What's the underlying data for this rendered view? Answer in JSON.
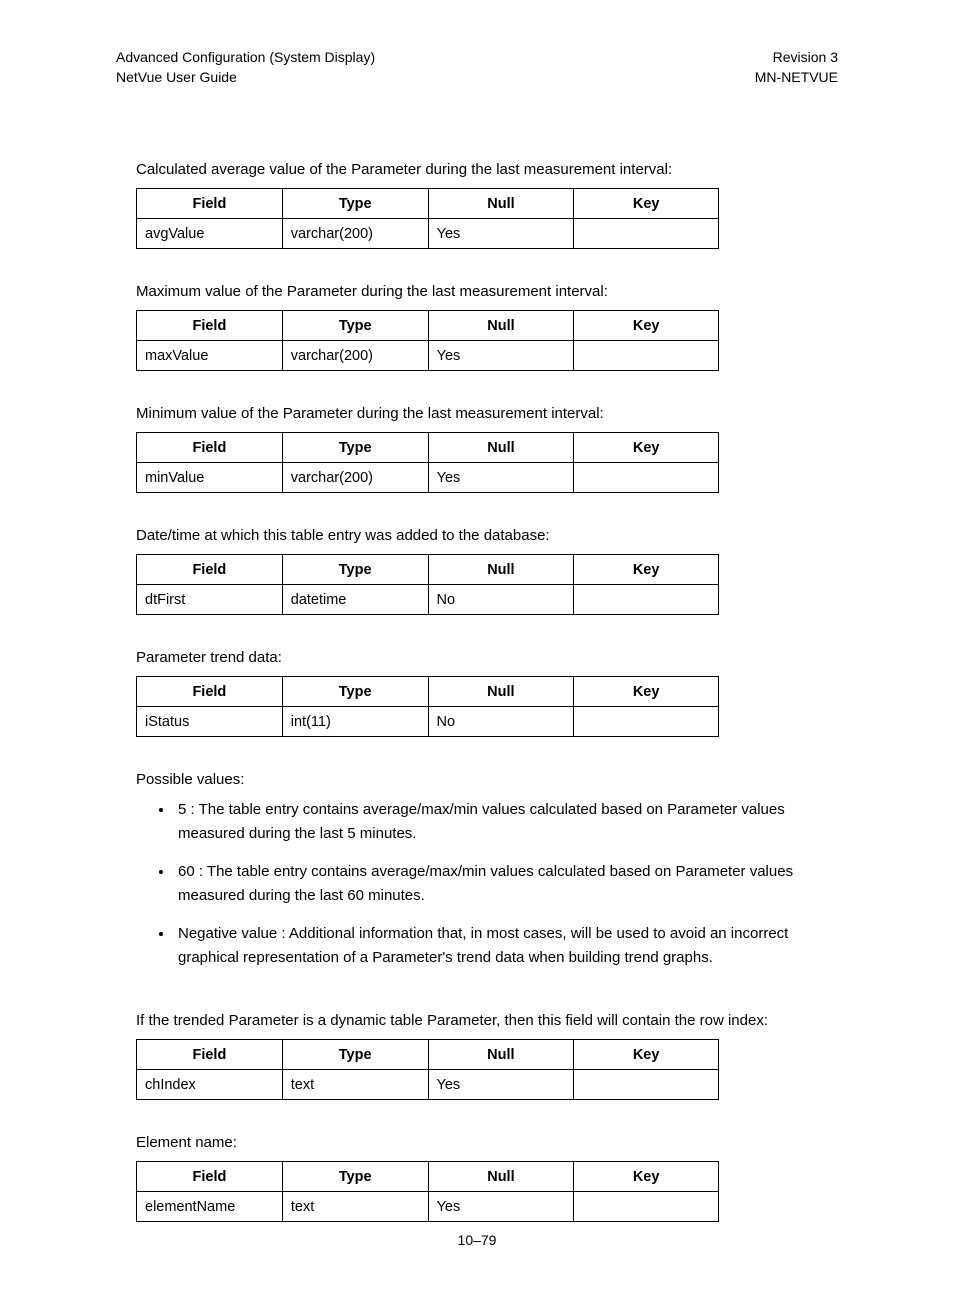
{
  "header": {
    "left_line1": "Advanced Configuration (System Display)",
    "left_line2": "NetVue User Guide",
    "right_line1": "Revision 3",
    "right_line2": "MN-NETVUE"
  },
  "tableHeaders": {
    "field": "Field",
    "type": "Type",
    "null": "Null",
    "key": "Key"
  },
  "sections": [
    {
      "desc": "Calculated average value of the Parameter during the last measurement interval:",
      "row": {
        "field": "avgValue",
        "type": "varchar(200)",
        "null": "Yes",
        "key": ""
      }
    },
    {
      "desc": "Maximum value of the Parameter during the last measurement interval:",
      "row": {
        "field": "maxValue",
        "type": "varchar(200)",
        "null": "Yes",
        "key": ""
      }
    },
    {
      "desc": "Minimum value of the Parameter during the last measurement interval:",
      "row": {
        "field": "minValue",
        "type": "varchar(200)",
        "null": "Yes",
        "key": ""
      }
    },
    {
      "desc": "Date/time at which this table entry was added to the database:",
      "row": {
        "field": "dtFirst",
        "type": "datetime",
        "null": "No",
        "key": ""
      }
    },
    {
      "desc": "Parameter trend data:",
      "row": {
        "field": "iStatus",
        "type": "int(11)",
        "null": "No",
        "key": ""
      },
      "sub_label": "Possible values:",
      "bullets": [
        "5 : The table entry contains average/max/min values calculated based on Parameter values measured during the last 5 minutes.",
        "60 : The table entry contains average/max/min values calculated based on Parameter values measured during the last 60 minutes.",
        "Negative value : Additional information that, in most cases, will be used to avoid an incorrect graphical representation of a Parameter's trend data when building trend graphs."
      ]
    },
    {
      "desc": "If the trended Parameter is a dynamic table Parameter, then this field will contain the row index:",
      "row": {
        "field": "chIndex",
        "type": "text",
        "null": "Yes",
        "key": ""
      }
    },
    {
      "desc": "Element name:",
      "row": {
        "field": "elementName",
        "type": "text",
        "null": "Yes",
        "key": ""
      }
    }
  ],
  "page_number": "10–79"
}
